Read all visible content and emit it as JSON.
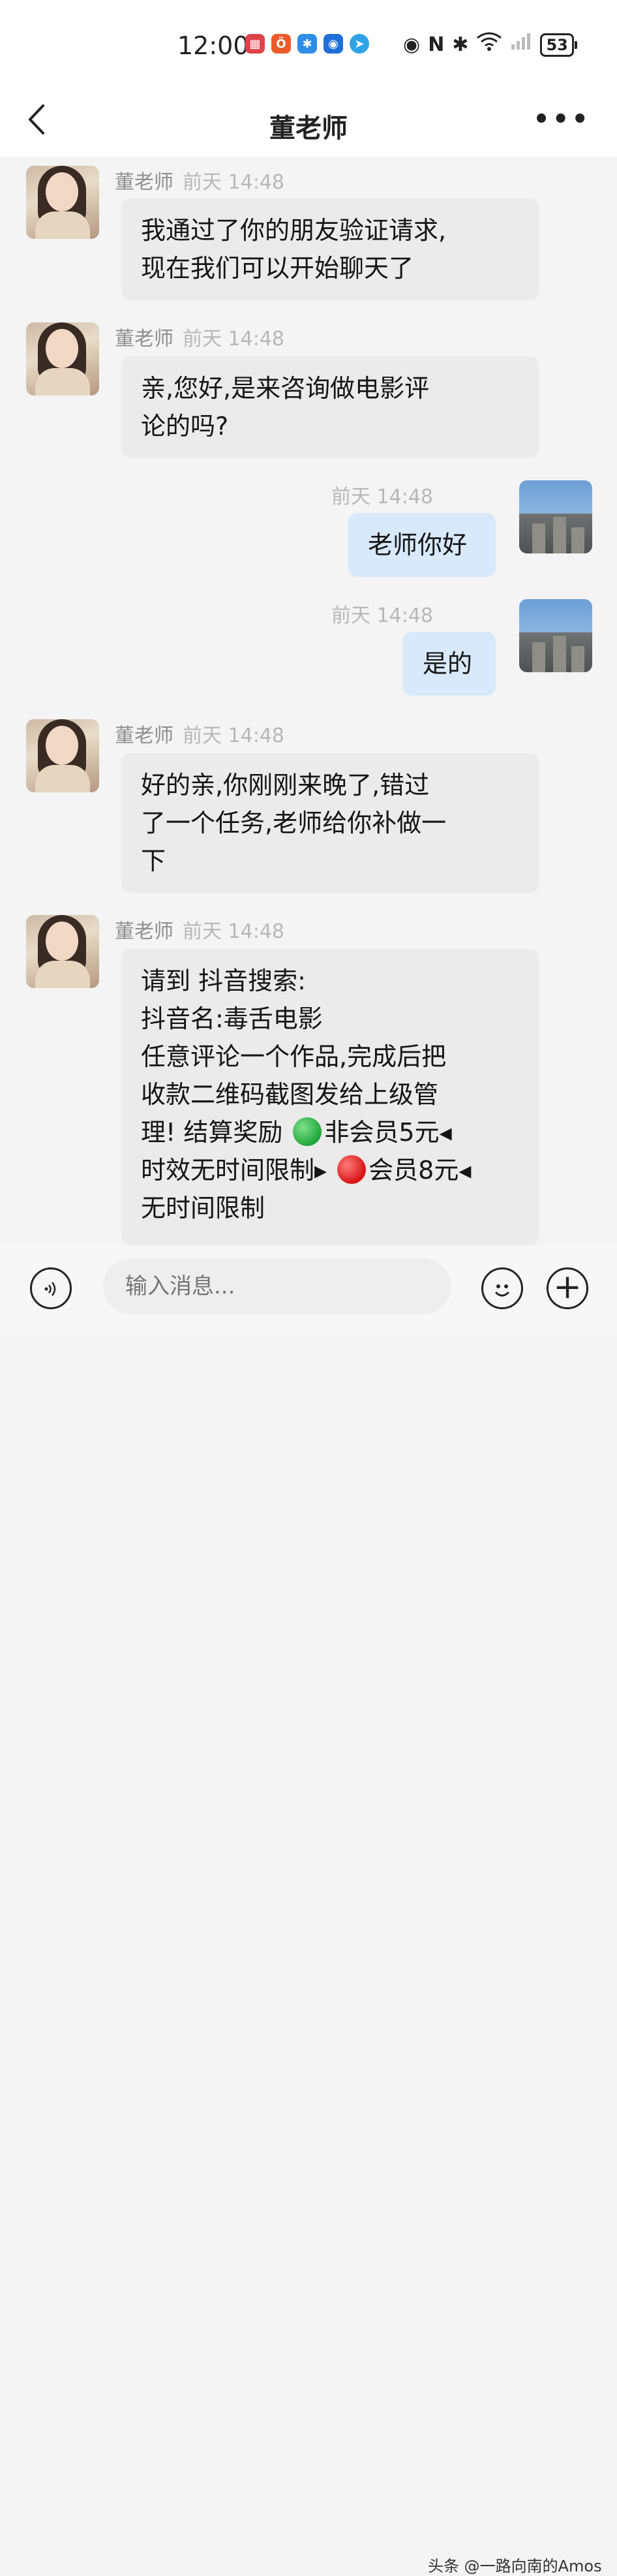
{
  "status_bar": {
    "time": "12:00",
    "battery": "53",
    "icons": [
      "eye-icon",
      "nfc-icon",
      "bluetooth-icon",
      "wifi-icon",
      "signal-icon"
    ]
  },
  "header": {
    "title": "董老师",
    "more": "•••"
  },
  "messages": [
    {
      "from": "teacher",
      "sender": "董老师",
      "time": "前天 14:48",
      "text": "我通过了你的朋友验证请求,\n现在我们可以开始聊天了"
    },
    {
      "from": "teacher",
      "sender": "董老师",
      "time": "前天 14:48",
      "text": "亲,您好,是来咨询做电影评\n论的吗?"
    },
    {
      "from": "me",
      "time": "前天 14:48",
      "text": "老师你好"
    },
    {
      "from": "me",
      "time": "前天 14:48",
      "text": "是的"
    },
    {
      "from": "teacher",
      "sender": "董老师",
      "time": "前天 14:48",
      "text": "好的亲,你刚刚来晚了,错过\n了一个任务,老师给你补做一\n下"
    },
    {
      "from": "teacher",
      "sender": "董老师",
      "time": "前天 14:48",
      "lines": [
        "请到 抖音搜索:",
        "抖音名:毒舌电影",
        "任意评论一个作品,完成后把",
        "收款二维码截图发给上级管",
        "理! 结算奖励",
        "非会员5元◂",
        "时效无时间限制▸",
        "会员8元◂",
        "无时间限制"
      ]
    }
  ],
  "input_bar": {
    "placeholder": "输入消息..."
  },
  "watermark": "头条 @一路向南的Amos"
}
